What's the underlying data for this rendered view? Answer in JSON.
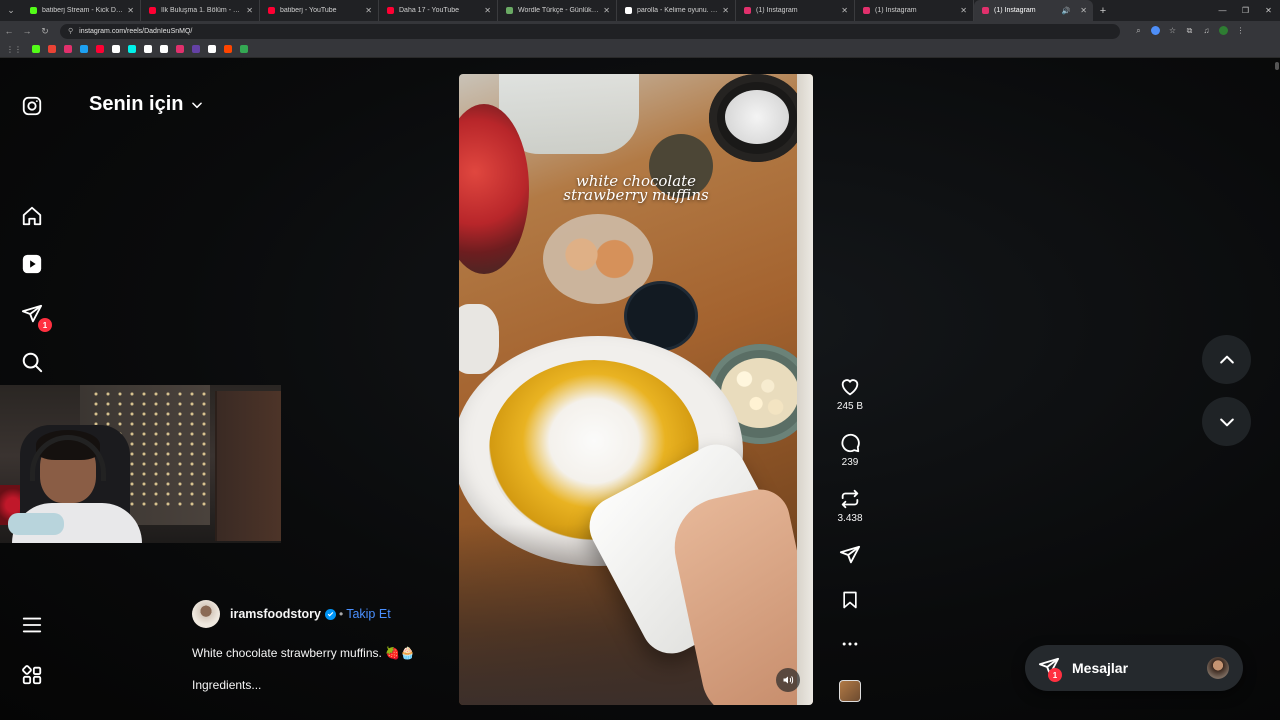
{
  "browser": {
    "tabs": [
      {
        "title": "batiberj Stream - Kick Dashbo...",
        "favicon_color": "#53fc18",
        "active": false
      },
      {
        "title": "İlk Buluşma 1. Bölüm - YouTube",
        "favicon_color": "#ff0033",
        "active": false
      },
      {
        "title": "batiberj - YouTube",
        "favicon_color": "#ff0033",
        "active": false
      },
      {
        "title": "Daha 17 - YouTube",
        "favicon_color": "#ff0033",
        "active": false
      },
      {
        "title": "Wordle Türkçe - Günlük Kelime",
        "favicon_color": "#6aaa64",
        "active": false
      },
      {
        "title": "parolla - Kelime oyunu. Günlük",
        "favicon_color": "#ffffff",
        "active": false
      },
      {
        "title": "(1) Instagram",
        "favicon_color": "#e1306c",
        "active": false
      },
      {
        "title": "(1) Instagram",
        "favicon_color": "#e1306c",
        "active": false
      },
      {
        "title": "(1) Instagram",
        "favicon_color": "#e1306c",
        "active": true
      }
    ],
    "url": "instagram.com/reels/DadnIeuSnMQ/",
    "bookmark_colors": [
      "#53fc18",
      "#ea4335",
      "#e1306c",
      "#1da1f2",
      "#ff0033",
      "#ffffff",
      "#00f2ea",
      "#ffffff",
      "#ffffff",
      "#e1306c",
      "#6441a5",
      "#ffffff",
      "#ff4500",
      "#34a853"
    ]
  },
  "sidebar": {
    "logo_icon": "instagram-icon",
    "items": [
      {
        "icon": "home-icon"
      },
      {
        "icon": "reels-icon"
      },
      {
        "icon": "messages-icon",
        "badge": "1"
      },
      {
        "icon": "search-icon"
      },
      {
        "icon": "menu-icon"
      },
      {
        "icon": "apps-icon"
      }
    ]
  },
  "feed": {
    "heading": "Senin için"
  },
  "reel": {
    "title_line1": "white chocolate",
    "title_line2": "strawberry muffins",
    "likes": "245 B",
    "comments": "239",
    "reposts": "3.438"
  },
  "caption": {
    "username": "iramsfoodstory",
    "separator": "•",
    "follow_label": "Takip Et",
    "text": "White chocolate strawberry muffins. 🍓🧁",
    "more": "Ingredients..."
  },
  "messages": {
    "label": "Mesajlar",
    "badge": "1"
  },
  "colors": {
    "accent_blue": "#0095f6",
    "follow_blue": "#4a90ff",
    "notification_red": "#ff3040"
  }
}
